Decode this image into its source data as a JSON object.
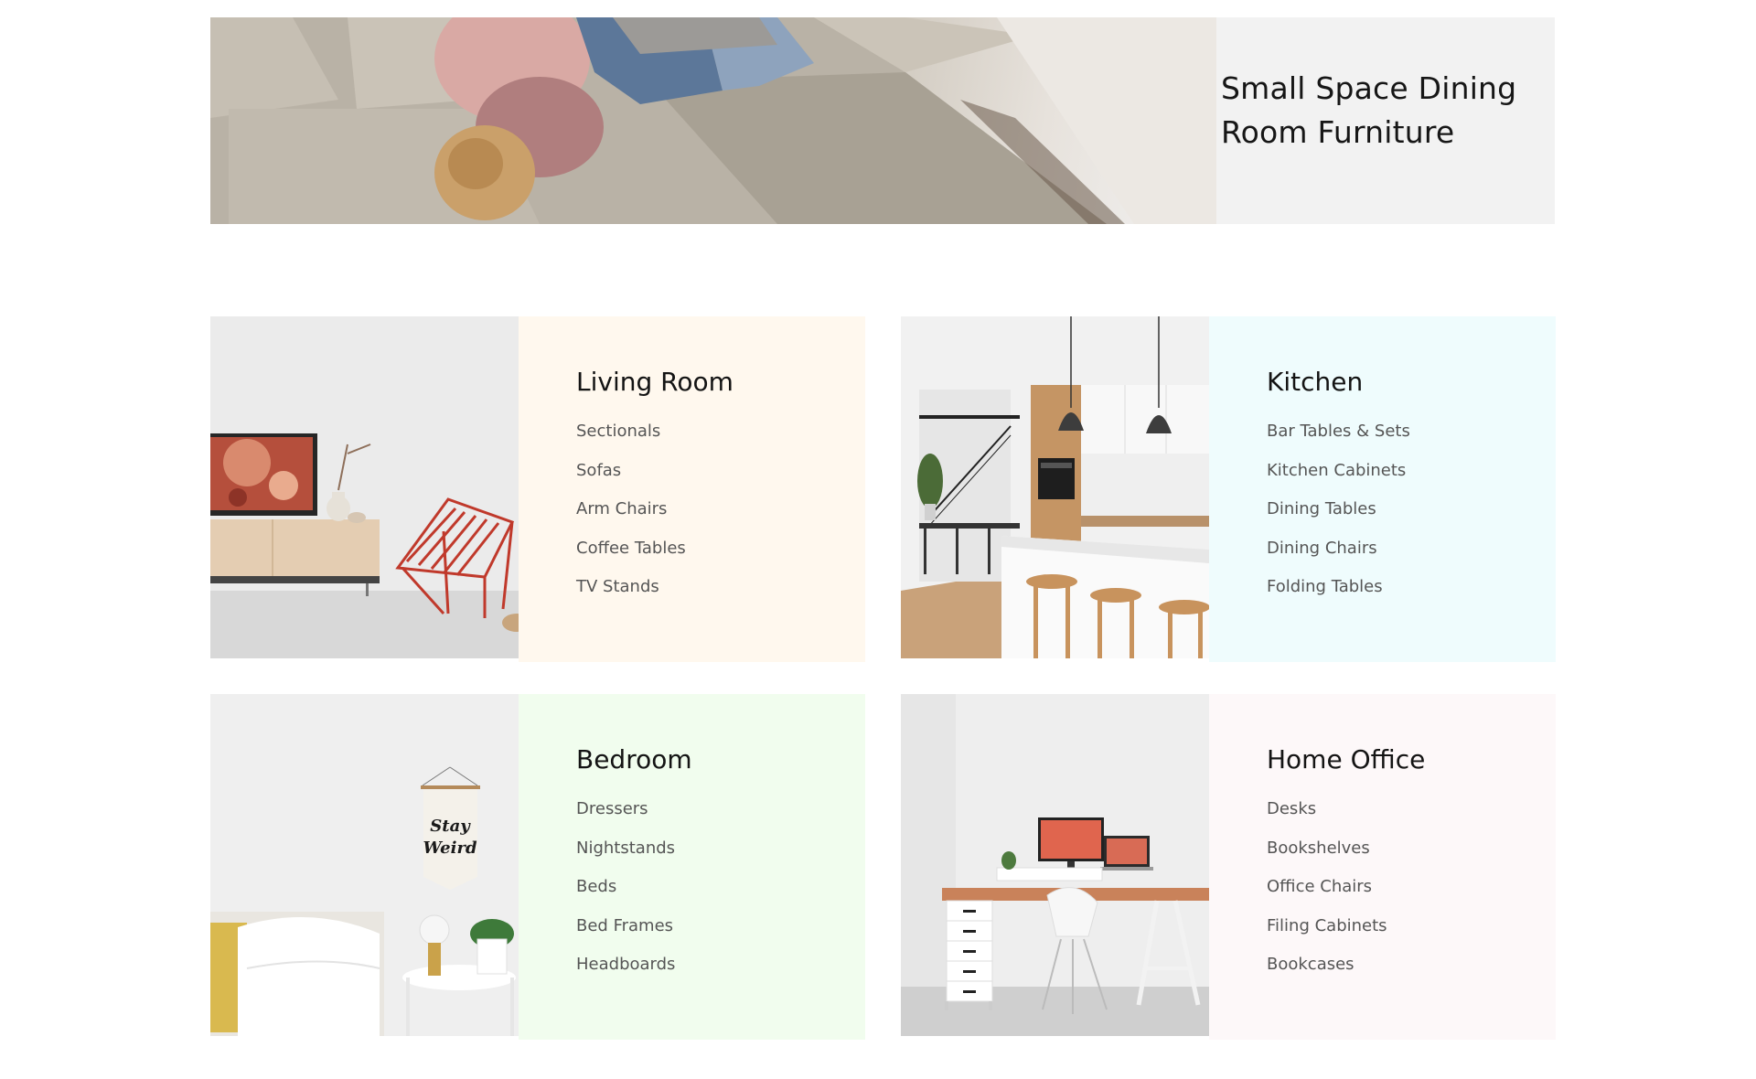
{
  "hero": {
    "title": "Small Space Dining Room Furniture",
    "image_alt": "woman-on-sofa-photo"
  },
  "colors": {
    "living_bg": "#fff8ee",
    "kitchen_bg": "#effcfd",
    "bedroom_bg": "#f1fdee",
    "office_bg": "#fdf8f9"
  },
  "categories": [
    {
      "title": "Living Room",
      "links": [
        "Sectionals",
        "Sofas",
        "Arm Chairs",
        "Coffee Tables",
        "TV Stands"
      ]
    },
    {
      "title": "Kitchen",
      "links": [
        "Bar Tables & Sets",
        "Kitchen Cabinets",
        "Dining Tables",
        "Dining Chairs",
        "Folding Tables"
      ]
    },
    {
      "title": "Bedroom",
      "links": [
        "Dressers",
        "Nightstands",
        "Beds",
        "Bed Frames",
        "Headboards"
      ]
    },
    {
      "title": "Home Office",
      "links": [
        "Desks",
        "Bookshelves",
        "Office Chairs",
        "Filing Cabinets",
        "Bookcases"
      ]
    }
  ],
  "pennant": {
    "line1": "Stay",
    "line2": "Weird"
  }
}
